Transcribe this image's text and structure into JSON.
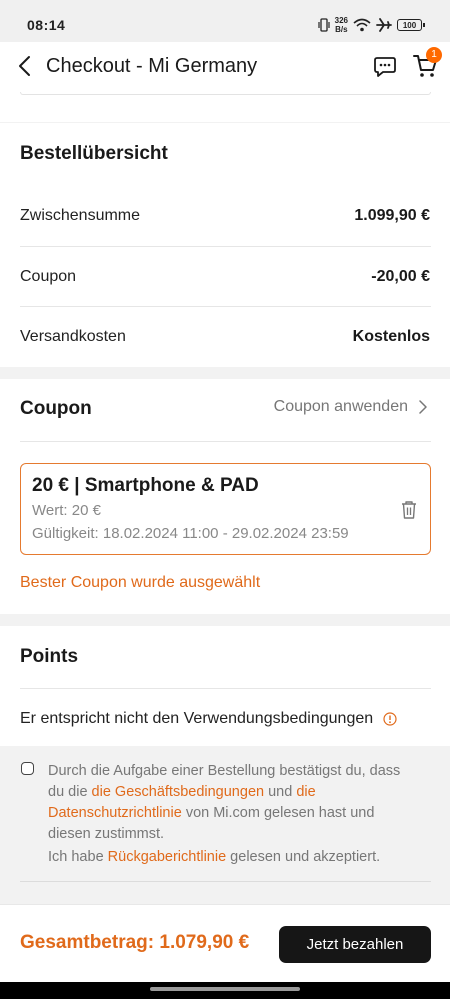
{
  "status_bar": {
    "time": "08:14",
    "net_speed_value": "326",
    "net_speed_unit": "B/s",
    "battery": "100"
  },
  "header": {
    "title": "Checkout - Mi Germany",
    "cart_count": "1"
  },
  "summary": {
    "title": "Bestellübersicht",
    "rows": [
      {
        "label": "Zwischensumme",
        "value": "1.099,90 €"
      },
      {
        "label": "Coupon",
        "value": "-20,00 €"
      },
      {
        "label": "Versandkosten",
        "value": "Kostenlos"
      }
    ]
  },
  "coupon": {
    "title": "Coupon",
    "apply_label": "Coupon anwenden",
    "card": {
      "name": "20 € | Smartphone & PAD",
      "value": "Wert: 20 €",
      "validity": "Gültigkeit: 18.02.2024 11:00 - 29.02.2024 23:59"
    },
    "best_coupon_note": "Bester Coupon wurde ausgewählt"
  },
  "points": {
    "title": "Points",
    "note": "Er entspricht nicht den Verwendungsbedingungen"
  },
  "terms": {
    "text_1": "Durch die Aufgabe einer Bestellung bestätigst du, dass du die ",
    "link_terms": "die Geschäftsbedingungen",
    "text_2": " und ",
    "link_privacy": "die Datenschutzrichtlinie",
    "text_3": " von Mi.com gelesen hast und diesen zustimmst.",
    "return_text_1": "Ich habe ",
    "link_return": "Rückgaberichtlinie",
    "return_text_2": " gelesen und akzeptiert.",
    "checked": false
  },
  "footer": {
    "total_label": "Gesamtbetrag: 1.079,90 €",
    "pay_button": "Jetzt bezahlen"
  },
  "colors": {
    "accent": "#e06a1b",
    "badge": "#ff6900",
    "button": "#161616"
  }
}
